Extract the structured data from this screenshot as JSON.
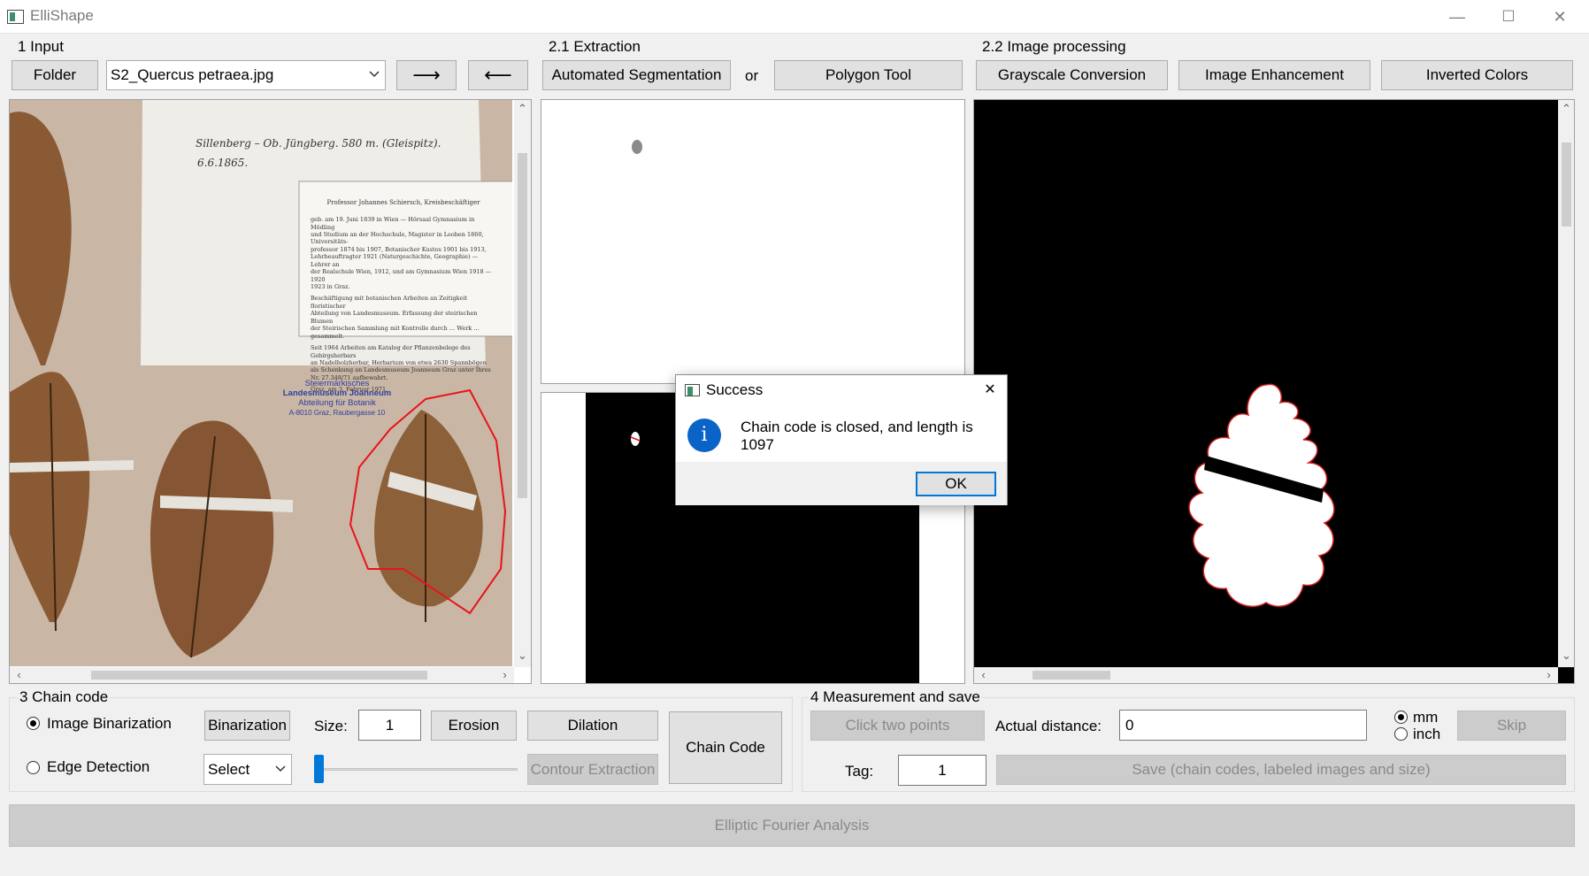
{
  "window": {
    "title": "ElliShape",
    "minimize": "—",
    "maximize": "☐",
    "close": "✕"
  },
  "input": {
    "label": "1 Input",
    "folder_btn": "Folder",
    "file_value": "S2_Quercus petraea.jpg",
    "next_btn": "⟶",
    "prev_btn": "⟵"
  },
  "extraction": {
    "label": "2.1 Extraction",
    "auto_btn": "Automated Segmentation",
    "or": "or",
    "polygon_btn": "Polygon Tool"
  },
  "processing": {
    "label": "2.2 Image processing",
    "gray_btn": "Grayscale Conversion",
    "enhance_btn": "Image Enhancement",
    "invert_btn": "Inverted Colors"
  },
  "specimen": {
    "handwriting": "Sillenberg – Ob. Jüngberg. 580 m. (Gleispitz).",
    "handwriting_date": "6.6.1865.",
    "label_title": "Professor Johannes Schiersch, Kreisbeschäftiger",
    "label_lines": [
      "geb. am 19. Juni 1839 in Wien — Hörsaal Gymnasium in Mödling",
      "und Studium an der Hochschule, Magister in Leoben 1860, Universitäts-",
      "professor 1874 bis 1907, Botanischer Kustos 1901 bis 1913,",
      "Lehrbeauftragter 1921 (Naturgeschichte, Geographie) — Lehrer an",
      "der Realschule Wien, 1912, und am Gymnasium Wien 1918 — 1920",
      "1923 in Graz.",
      "Beschäftigung mit botanischen Arbeiten an Zeitigkeit floristischer",
      "Abteilung von Landesmuseum. Erfassung der steirischen Blumen",
      "der Steirischen Sammlung mit Kontrolle durch … Werk … gesammelt.",
      "Seit 1964 Arbeiten am Katalog der Pflanzenbelege des Gebirgsherbars",
      "an Nadelholzherbar, Herbarium von etwa 2630 Spannbögen",
      "als Schenkung an Landesmuseum Joanneum Graz unter Ihres",
      "Nr. 27.348/71 aufbewahrt.",
      "Graz, am 3. Februar 1971."
    ],
    "stamp": [
      "Steiermärkisches",
      "Landesmuseum Joanneum",
      "Abteilung für Botanik",
      "A-8010 Graz, Raubergasse 10"
    ]
  },
  "dialog": {
    "title": "Success",
    "message": "Chain code is closed, and length is 1097",
    "ok_btn": "OK",
    "close": "✕",
    "info_glyph": "i"
  },
  "chain": {
    "label": "3 Chain code",
    "radio_binarization": "Image Binarization",
    "radio_edge": "Edge Detection",
    "binarization_btn": "Binarization",
    "size_label": "Size:",
    "size_value": "1",
    "erosion_btn": "Erosion",
    "dilation_btn": "Dilation",
    "select_value": "Select",
    "contour_btn": "Contour Extraction",
    "chain_btn": "Chain Code",
    "slider_value": 0
  },
  "measure": {
    "label": "4 Measurement and save",
    "click_btn": "Click two points",
    "distance_label": "Actual distance:",
    "distance_value": "0",
    "unit_mm": "mm",
    "unit_inch": "inch",
    "skip_btn": "Skip",
    "tag_label": "Tag:",
    "tag_value": "1",
    "save_btn": "Save (chain codes, labeled images and size)"
  },
  "efa_btn": "Elliptic Fourier Analysis",
  "colors": {
    "polygon": "#e8141a",
    "contour": "#d11f1f",
    "info_blue": "#0a64c8",
    "leaf": "#8a5a34"
  }
}
